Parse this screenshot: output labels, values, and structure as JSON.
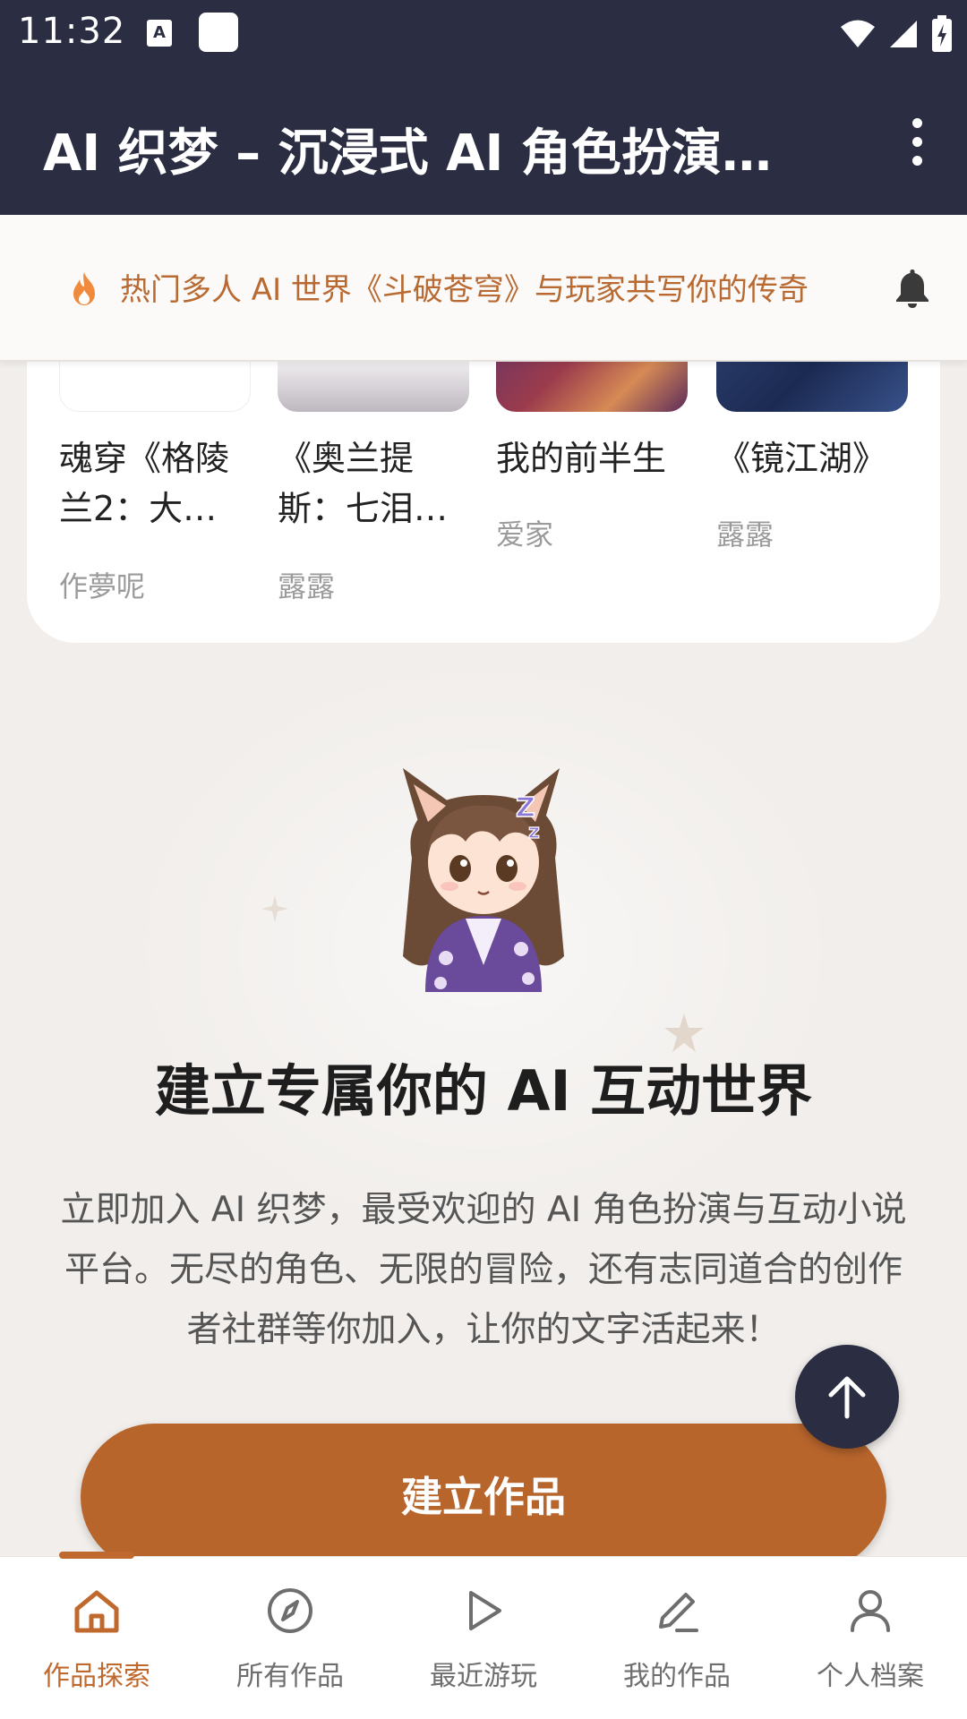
{
  "status_bar": {
    "time": "11:32",
    "a_badge": "A"
  },
  "app_bar": {
    "title": "AI 织梦 – 沉浸式 AI 角色扮演…",
    "more_icon": "more-vertical-icon"
  },
  "notice": {
    "text": "热门多人 AI 世界《斗破苍穹》与玩家共写你的传奇",
    "left_icon": "fire-icon",
    "right_icon": "bell-icon"
  },
  "works": [
    {
      "title": "魂穿《格陵兰2：大…",
      "author": "作夢呢"
    },
    {
      "title": "《奥兰提斯：七泪…",
      "author": "露露"
    },
    {
      "title": "我的前半生",
      "author": "爱家"
    },
    {
      "title": "《镜江湖》",
      "author": "露露"
    }
  ],
  "hero": {
    "title": "建立专属你的 AI 互动世界",
    "description": "立即加入 AI 织梦，最受欢迎的 AI 角色扮演与互动小说平台。无尽的角色、无限的冒险，还有志同道合的创作者社群等你加入，让你的文字活起来！",
    "mascot_caption": "Z"
  },
  "create_button": {
    "label": "建立作品"
  },
  "bottom_nav": {
    "items": [
      {
        "label": "作品探索",
        "icon": "home-icon"
      },
      {
        "label": "所有作品",
        "icon": "compass-icon"
      },
      {
        "label": "最近游玩",
        "icon": "play-icon"
      },
      {
        "label": "我的作品",
        "icon": "pen-icon"
      },
      {
        "label": "个人档案",
        "icon": "person-icon"
      }
    ]
  },
  "colors": {
    "primary": "#2b2d42",
    "accent": "#b8652c",
    "background": "#f1eeeb"
  }
}
